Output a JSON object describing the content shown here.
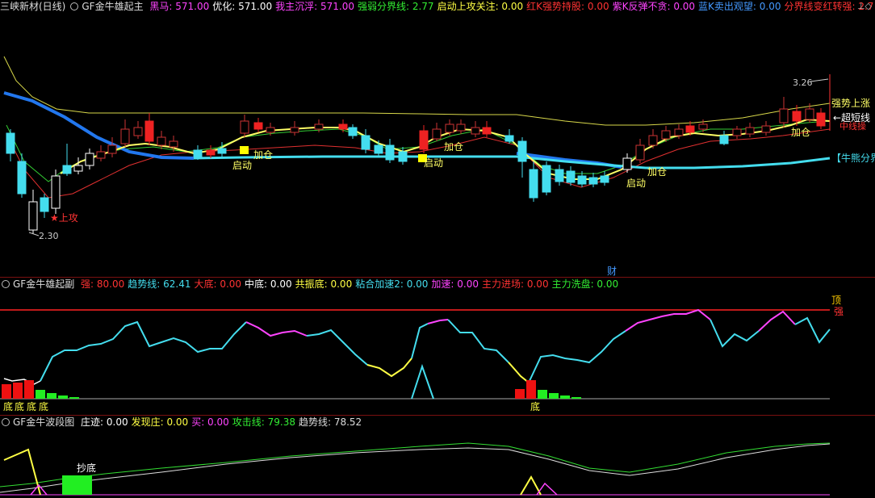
{
  "panel1": {
    "title": "三峡新材(日线)",
    "indicator": "GF金牛雄起主",
    "fields": [
      {
        "label": "黑马: 571.00",
        "color": "#ff44ff"
      },
      {
        "label": "优化: 571.00",
        "color": "#ffffff"
      },
      {
        "label": "我主沉浮: 571.00",
        "color": "#ff44ff"
      },
      {
        "label": "强弱分界线: 2.77",
        "color": "#33ee33"
      },
      {
        "label": "启动上攻关注: 0.00",
        "color": "#ffff44"
      },
      {
        "label": "红K强势持股: 0.00",
        "color": "#ff3333"
      },
      {
        "label": "紫K反弹不贪: 0.00",
        "color": "#ff44ff"
      },
      {
        "label": "蓝K卖出观望: 0.00",
        "color": "#4499ff"
      },
      {
        "label": "分界线变红转强: 2.7",
        "color": "#ff3333"
      }
    ],
    "annotations": {
      "high": "3.26",
      "low": "2.30",
      "shanggong": "★上攻",
      "qidong": "启动",
      "jiacang": "加仓",
      "strong_up": "强势上涨",
      "super_short": "←超短线",
      "mid_trend": "中线操",
      "bear_line": "【牛熊分界",
      "cai": "财"
    },
    "controls": "⊥◇"
  },
  "panel2": {
    "indicator": "GF金牛雄起副",
    "fields": [
      {
        "label": "强: 80.00",
        "color": "#ff3333"
      },
      {
        "label": "趋势线: 62.41",
        "color": "#44ddee"
      },
      {
        "label": "大底: 0.00",
        "color": "#ff3333"
      },
      {
        "label": "中底: 0.00",
        "color": "#ffffff"
      },
      {
        "label": "共振底: 0.00",
        "color": "#ffff44"
      },
      {
        "label": "粘合加速2: 0.00",
        "color": "#44ddee"
      },
      {
        "label": "加速: 0.00",
        "color": "#ff44ff"
      },
      {
        "label": "主力进场: 0.00",
        "color": "#ff3333"
      },
      {
        "label": "主力洗盘: 0.00",
        "color": "#33ee33"
      }
    ],
    "labels": {
      "top": "顶",
      "strong": "强",
      "di": "底"
    }
  },
  "panel3": {
    "indicator": "GF金牛波段图",
    "fields": [
      {
        "label": "庄迹: 0.00",
        "color": "#ffffff"
      },
      {
        "label": "发现庄: 0.00",
        "color": "#ffff44"
      },
      {
        "label": "买: 0.00",
        "color": "#ff44ff"
      },
      {
        "label": "攻击线: 79.38",
        "color": "#33ee33"
      },
      {
        "label": "趋势线: 78.52",
        "color": "#dddddd"
      }
    ],
    "labels": {
      "chaodi": "抄底"
    }
  },
  "chart_data": {
    "type": "candlestick",
    "price_high": 3.26,
    "price_low": 2.3,
    "trend_line": [
      62.41
    ],
    "strength_line": 80.0,
    "attack_line": 79.38,
    "trend_line_3": 78.52
  }
}
